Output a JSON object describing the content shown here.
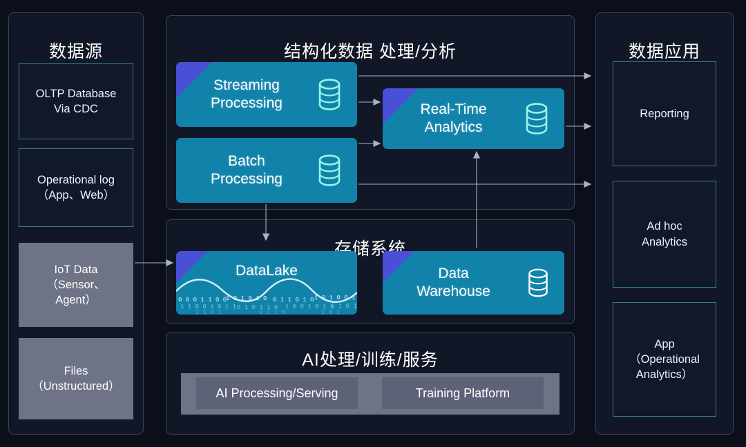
{
  "columns": {
    "sources": {
      "title": "数据源",
      "items": [
        {
          "name": "oltp-database",
          "label": "OLTP Database\nVia CDC",
          "style": "outline"
        },
        {
          "name": "operational-log",
          "label": "Operational log\n（App、Web）",
          "style": "outline"
        },
        {
          "name": "iot-data",
          "label": "IoT Data\n（Sensor、\nAgent）",
          "style": "gray"
        },
        {
          "name": "files",
          "label": "Files\n（Unstructured）",
          "style": "gray"
        }
      ]
    },
    "applications": {
      "title": "数据应用",
      "items": [
        {
          "name": "reporting",
          "label": "Reporting"
        },
        {
          "name": "ad-hoc-analytics",
          "label": "Ad hoc\nAnalytics"
        },
        {
          "name": "app-operational-analytics",
          "label": "App\n（Operational\nAnalytics）"
        }
      ]
    }
  },
  "sections": {
    "processing": {
      "title": "结构化数据 处理/分析",
      "cards": [
        {
          "name": "streaming-processing",
          "label": "Streaming\nProcessing",
          "icon": "database-icon"
        },
        {
          "name": "batch-processing",
          "label": "Batch\nProcessing",
          "icon": "database-icon"
        },
        {
          "name": "real-time-analytics",
          "label": "Real-Time\nAnalytics",
          "icon": "database-icon"
        }
      ]
    },
    "storage": {
      "title": "存储系统",
      "cards": [
        {
          "name": "datalake",
          "label": "DataLake",
          "icon": "wave-binary-art"
        },
        {
          "name": "data-warehouse",
          "label": "Data\nWarehouse",
          "icon": "database-icon"
        }
      ]
    },
    "ai": {
      "title": "AI处理/训练/服务",
      "chips": [
        {
          "name": "ai-processing-serving",
          "label": "AI Processing/Serving"
        },
        {
          "name": "training-platform",
          "label": "Training Platform"
        }
      ]
    }
  },
  "colors": {
    "background": "#0b0f1a",
    "panel": "#111726",
    "panel_border": "#3b4558",
    "teal_card": "#1183ab",
    "corner_accent": "#4a4fd6",
    "gray_box": "#6e7385",
    "outline_border": "#3f7f92",
    "icon_cyan": "#9bf4e8",
    "wire": "#98a3b8"
  },
  "connections": [
    {
      "from": "iot-data",
      "to": "storage-section"
    },
    {
      "from": "streaming-processing",
      "to": "real-time-analytics"
    },
    {
      "from": "streaming-processing",
      "to": "reporting"
    },
    {
      "from": "batch-processing",
      "to": "real-time-analytics"
    },
    {
      "from": "batch-processing",
      "to": "app-operational-analytics"
    },
    {
      "from": "batch-processing",
      "to": "storage-section"
    },
    {
      "from": "real-time-analytics",
      "to": "ad-hoc-analytics"
    },
    {
      "from": "data-warehouse",
      "to": "real-time-analytics"
    }
  ]
}
